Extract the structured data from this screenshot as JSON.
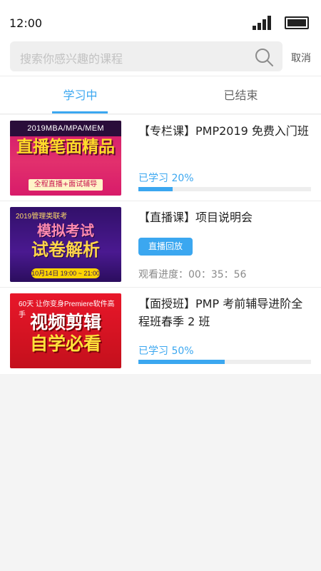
{
  "status_bar": {
    "time": "12:00"
  },
  "search": {
    "placeholder": "搜索你感兴趣的课程",
    "cancel_label": "取消"
  },
  "tabs": [
    {
      "label": "学习中",
      "active": true
    },
    {
      "label": "已结束",
      "active": false
    }
  ],
  "colors": {
    "accent": "#3ba7f0"
  },
  "courses": [
    {
      "title": "【专栏课】PMP2019 免费入门班",
      "progress_label": "已学习 20%",
      "progress": 0.2,
      "thumb": {
        "top": "2019MBA/MPA/MEM",
        "main": "直播笔面精品",
        "bar": "全程直播+面试辅导"
      }
    },
    {
      "title": "【直播课】项目说明会",
      "replay_label": "直播回放",
      "watch_progress": "观看进度：00：35：56",
      "thumb": {
        "top": "2019管理类联考",
        "main1": "模拟考试",
        "main2": "试卷解析",
        "bar": "10月14日 19:00 ~ 21:00"
      }
    },
    {
      "title": "【面授班】PMP  考前辅导进阶全程班春季 2 班",
      "progress_label": "已学习 50%",
      "progress": 0.5,
      "thumb": {
        "top": "60天 让你变身Premiere软件高手",
        "main1": "视频剪辑",
        "main2": "自学必看"
      }
    }
  ]
}
